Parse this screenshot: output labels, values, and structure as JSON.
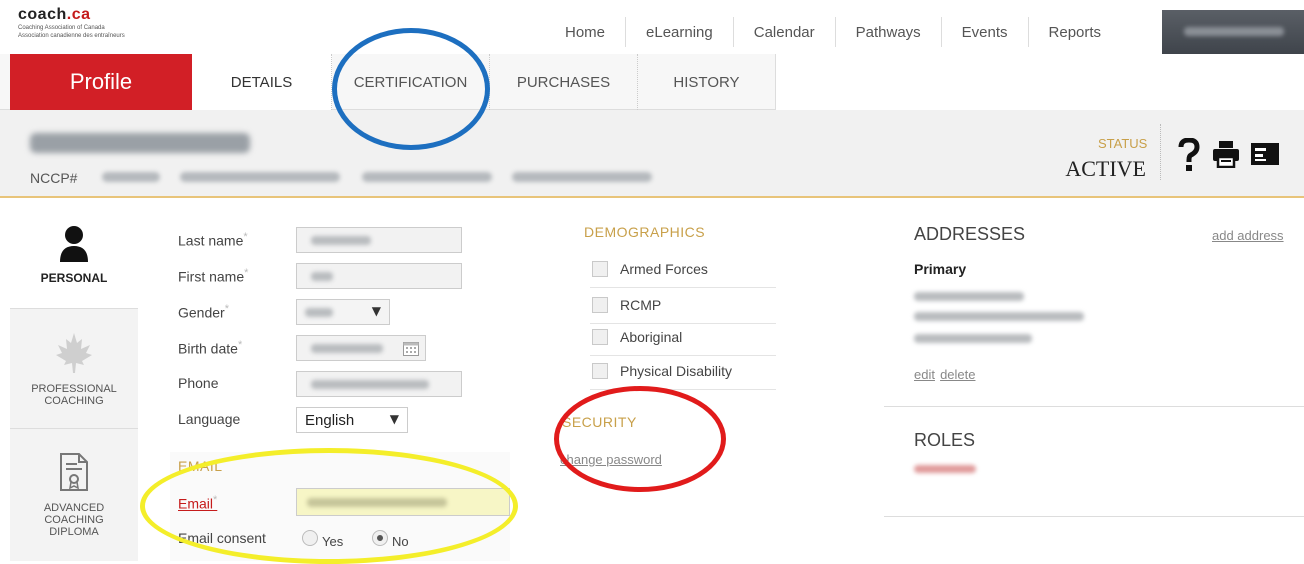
{
  "logo": {
    "name": "coach",
    "suffix": ".ca",
    "tagline_en": "Coaching Association of Canada",
    "tagline_fr": "Association canadienne des entraîneurs"
  },
  "topnav": [
    {
      "label": "Home"
    },
    {
      "label": "eLearning"
    },
    {
      "label": "Calendar"
    },
    {
      "label": "Pathways"
    },
    {
      "label": "Events"
    },
    {
      "label": "Reports"
    }
  ],
  "tabs": {
    "profile": "Profile",
    "items": [
      {
        "label": "DETAILS"
      },
      {
        "label": "CERTIFICATION"
      },
      {
        "label": "PURCHASES"
      },
      {
        "label": "HISTORY"
      }
    ]
  },
  "header": {
    "nccp_label": "NCCP#",
    "status_label": "STATUS",
    "status_value": "ACTIVE"
  },
  "sidebar": {
    "items": [
      {
        "label": "PERSONAL",
        "icon": "person-icon"
      },
      {
        "label": "PROFESSIONAL COACHING",
        "icon": "maple-leaf-icon"
      },
      {
        "label": "ADVANCED COACHING DIPLOMA",
        "icon": "certificate-icon"
      }
    ]
  },
  "form": {
    "last_name": "Last name",
    "first_name": "First name",
    "gender": "Gender",
    "birth_date": "Birth date",
    "phone": "Phone",
    "language": "Language",
    "language_value": "English",
    "required_mark": "*"
  },
  "email": {
    "title": "EMAIL",
    "email_label": "Email",
    "consent_label": "Email consent",
    "yes": "Yes",
    "no": "No",
    "consent_value": "No"
  },
  "demographics": {
    "title": "DEMOGRAPHICS",
    "items": [
      {
        "label": "Armed Forces",
        "checked": false
      },
      {
        "label": "RCMP",
        "checked": false
      },
      {
        "label": "Aboriginal",
        "checked": false
      },
      {
        "label": "Physical Disability",
        "checked": false
      }
    ]
  },
  "security": {
    "title": "SECURITY",
    "change_password": "change password"
  },
  "addresses": {
    "title": "ADDRESSES",
    "add_address": "add address",
    "primary": "Primary",
    "edit": "edit",
    "delete": "delete"
  },
  "roles": {
    "title": "ROLES"
  },
  "colors": {
    "brand_red": "#d21f26",
    "gold": "#c8a04a",
    "annot_blue": "#1d6fc0",
    "annot_red": "#e11b1b",
    "annot_yellow": "#f4ee2a"
  }
}
